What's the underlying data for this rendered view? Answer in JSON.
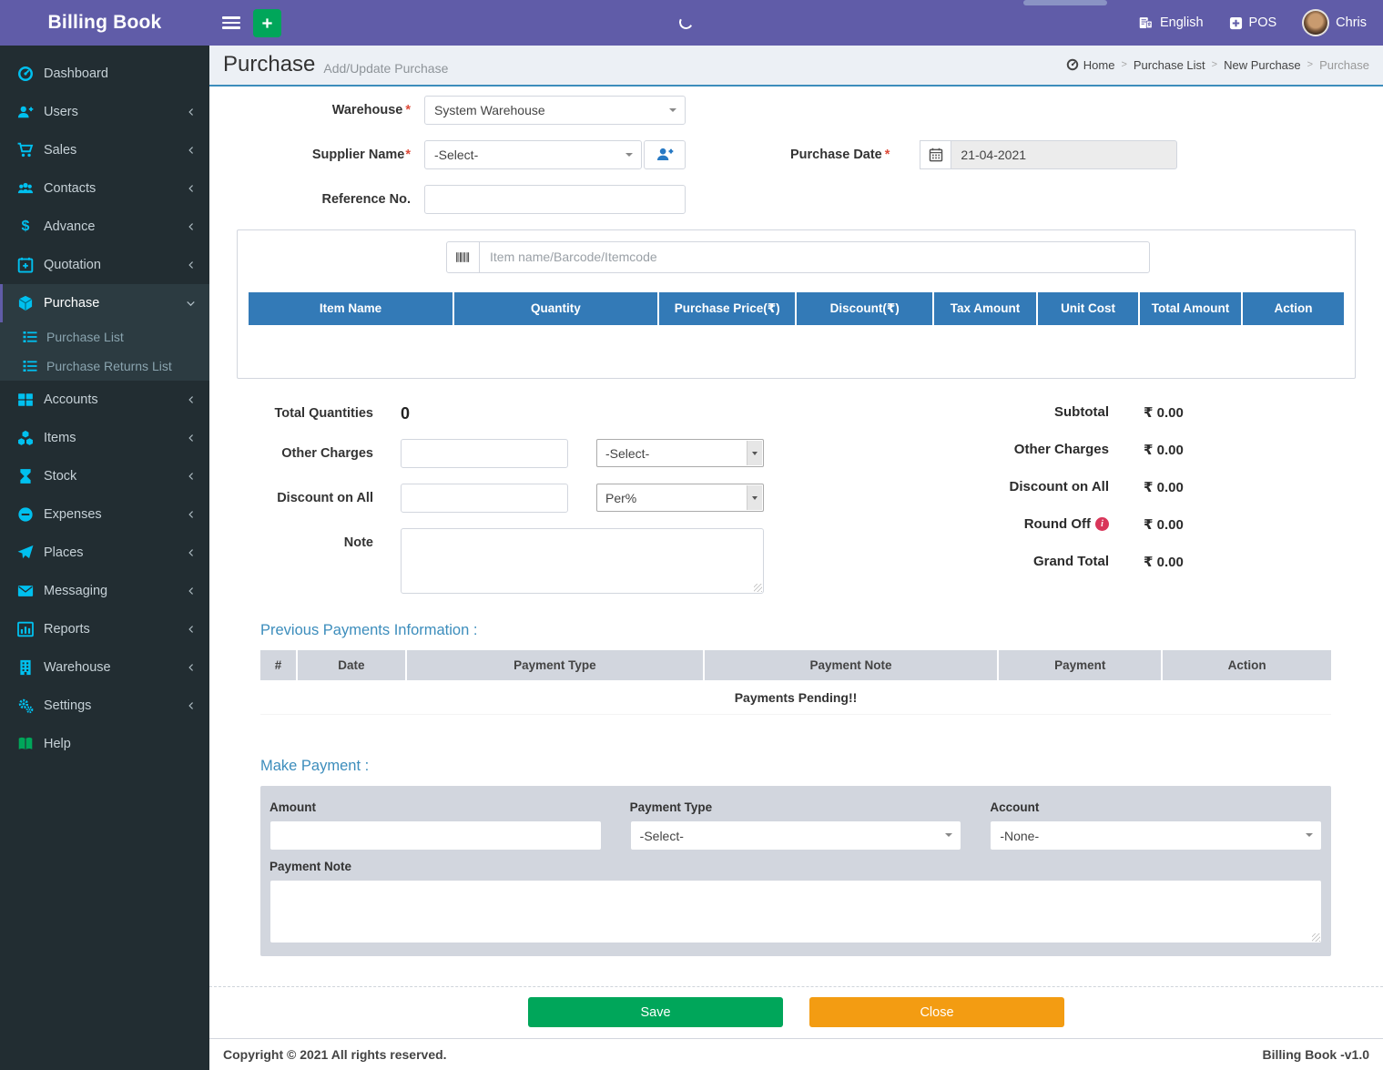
{
  "app": {
    "title": "Billing Book",
    "copyright": "Copyright © 2021 All rights reserved.",
    "version": "Billing Book -v1.0"
  },
  "topbar": {
    "language": "English",
    "pos": "POS",
    "username": "Chris"
  },
  "sidebar": {
    "items": [
      {
        "label": "Dashboard",
        "icon": "dashboard-icon"
      },
      {
        "label": "Users",
        "icon": "user-plus-icon"
      },
      {
        "label": "Sales",
        "icon": "cart-icon"
      },
      {
        "label": "Contacts",
        "icon": "users-group-icon"
      },
      {
        "label": "Advance",
        "icon": "dollar-icon"
      },
      {
        "label": "Quotation",
        "icon": "calendar-plus-icon"
      },
      {
        "label": "Purchase",
        "icon": "cube-icon",
        "active": true
      },
      {
        "label": "Accounts",
        "icon": "grid-icon"
      },
      {
        "label": "Items",
        "icon": "cubes-icon"
      },
      {
        "label": "Stock",
        "icon": "hourglass-icon"
      },
      {
        "label": "Expenses",
        "icon": "minus-circle-icon"
      },
      {
        "label": "Places",
        "icon": "paper-plane-icon"
      },
      {
        "label": "Messaging",
        "icon": "envelope-icon"
      },
      {
        "label": "Reports",
        "icon": "bar-chart-icon"
      },
      {
        "label": "Warehouse",
        "icon": "building-icon"
      },
      {
        "label": "Settings",
        "icon": "gears-icon"
      },
      {
        "label": "Help",
        "icon": "book-icon"
      }
    ],
    "purchase_submenu": [
      {
        "label": "Purchase List"
      },
      {
        "label": "Purchase Returns List"
      }
    ]
  },
  "page": {
    "title": "Purchase",
    "subtitle": "Add/Update Purchase",
    "breadcrumb": {
      "home": "Home",
      "purchase_list": "Purchase List",
      "new_purchase": "New Purchase",
      "current": "Purchase",
      "separator": ">"
    }
  },
  "form": {
    "required_mark": "*",
    "warehouse_label": "Warehouse",
    "warehouse_value": "System Warehouse",
    "supplier_label": "Supplier Name",
    "supplier_value": "-Select-",
    "purchase_date_label": "Purchase Date",
    "purchase_date_value": "21-04-2021",
    "reference_label": "Reference No.",
    "item_search_placeholder": "Item name/Barcode/Itemcode"
  },
  "items_table": {
    "columns": [
      "Item Name",
      "Quantity",
      "Purchase Price(₹)",
      "Discount(₹)",
      "Tax Amount",
      "Unit Cost",
      "Total Amount",
      "Action"
    ]
  },
  "totals": {
    "total_quantities_label": "Total Quantities",
    "total_quantities_value": "0",
    "other_charges_label": "Other Charges",
    "other_charges_type_value": "-Select-",
    "discount_on_all_label": "Discount on All",
    "discount_type_value": "Per%",
    "note_label": "Note",
    "summary": [
      {
        "label": "Subtotal",
        "value": "₹ 0.00"
      },
      {
        "label": "Other Charges",
        "value": "₹ 0.00"
      },
      {
        "label": "Discount on All",
        "value": "₹ 0.00"
      },
      {
        "label": "Round Off",
        "value": "₹ 0.00"
      },
      {
        "label": "Grand Total",
        "value": "₹ 0.00"
      }
    ]
  },
  "previous_payments": {
    "heading": "Previous Payments Information :",
    "columns": [
      "#",
      "Date",
      "Payment Type",
      "Payment Note",
      "Payment",
      "Action"
    ],
    "empty_message": "Payments Pending!!"
  },
  "make_payment": {
    "heading": "Make Payment :",
    "amount_label": "Amount",
    "payment_type_label": "Payment Type",
    "payment_type_value": "-Select-",
    "account_label": "Account",
    "account_value": "-None-",
    "payment_note_label": "Payment Note"
  },
  "actions": {
    "save": "Save",
    "close": "Close"
  },
  "colors": {
    "header_purple": "#605ca8",
    "sidebar_dark": "#222d32",
    "sidebar_icon_cyan": "#00c0ef",
    "table_header_blue": "#337ab7",
    "section_heading_blue": "#3c8dbc",
    "success_green": "#00a65a",
    "warning_orange": "#f39c12",
    "danger_red": "#dd4b39",
    "panel_gray": "#d2d6de"
  }
}
